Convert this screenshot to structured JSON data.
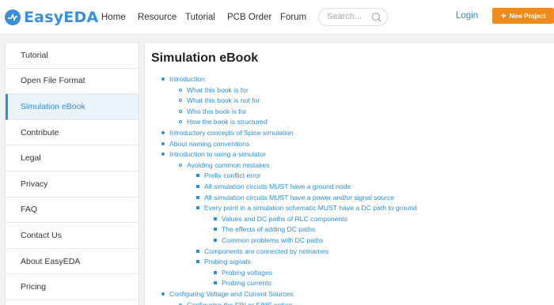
{
  "header": {
    "logo_text": "EasyEDA",
    "nav": [
      "Home",
      "Resource",
      "Tutorial",
      "PCB Order",
      "Forum"
    ],
    "search_placeholder": "Search...",
    "login_label": "Login",
    "new_project_label": "New Project",
    "accent_color": "#2d8fd5",
    "button_color": "#f28b1e"
  },
  "sidebar": {
    "items": [
      {
        "label": "Tutorial",
        "active": false
      },
      {
        "label": "Open File Format",
        "active": false
      },
      {
        "label": "Simulation eBook",
        "active": true
      },
      {
        "label": "Contribute",
        "active": false
      },
      {
        "label": "Legal",
        "active": false
      },
      {
        "label": "Privacy",
        "active": false
      },
      {
        "label": "FAQ",
        "active": false
      },
      {
        "label": "Contact Us",
        "active": false
      },
      {
        "label": "About EasyEDA",
        "active": false
      },
      {
        "label": "Pricing",
        "active": false
      }
    ]
  },
  "main": {
    "title": "Simulation eBook",
    "toc": [
      {
        "level": 1,
        "text": "Introduction"
      },
      {
        "level": 2,
        "text": "What this book is for"
      },
      {
        "level": 2,
        "text": "What this book is not for"
      },
      {
        "level": 2,
        "text": "Who this book is for"
      },
      {
        "level": 2,
        "text": "How the book is structured"
      },
      {
        "level": 1,
        "text": "Introductory concepts of Spice simulation"
      },
      {
        "level": 1,
        "text": "About naming conventions"
      },
      {
        "level": 1,
        "text": "Introduction to using a simulator"
      },
      {
        "level": 2,
        "text": "Avoiding common mistakes"
      },
      {
        "level": 3,
        "text": "Prefix conflict error"
      },
      {
        "level": 3,
        "text": "All simulation circuits MUST have a ground node"
      },
      {
        "level": 3,
        "text": "All simulation circuits MUST have a power and/or signal source"
      },
      {
        "level": 3,
        "text": "Every point in a simulation schematic MUST have a DC path to ground"
      },
      {
        "level": 4,
        "text": "Values and DC paths of RLC components"
      },
      {
        "level": 4,
        "text": "The effects of adding DC paths"
      },
      {
        "level": 4,
        "text": "Common problems with DC paths"
      },
      {
        "level": 3,
        "text": "Components are connected by netnames"
      },
      {
        "level": 3,
        "text": "Probing signals"
      },
      {
        "level": 4,
        "text": "Probing voltages"
      },
      {
        "level": 4,
        "text": "Probing currents"
      },
      {
        "level": 1,
        "text": "Configuring Voltage and Current Sources"
      },
      {
        "level": 2,
        "text": "Configuring the SIN or SINE option"
      }
    ]
  }
}
